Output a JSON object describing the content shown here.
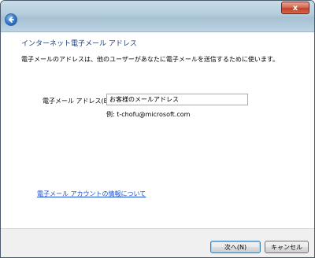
{
  "titlebar": {
    "close_symbol": "x",
    "back_icon": "back-arrow-icon"
  },
  "wizard": {
    "heading": "インターネット電子メール アドレス",
    "description": "電子メールのアドレスは、他のユーザーがあなたに電子メールを送信するために使います。",
    "email_label": "電子メール アドレス(E):",
    "email_value": "お客様のメールアドレス",
    "example": "例: t-chofu@microsoft.com",
    "help_link": "電子メール アカウントの情報について"
  },
  "footer": {
    "next_label": "次へ(N)",
    "cancel_label": "キャンセル"
  },
  "colors": {
    "heading": "#1f3f7a",
    "link": "#1a4ed0",
    "close_button": "#c2412a"
  }
}
